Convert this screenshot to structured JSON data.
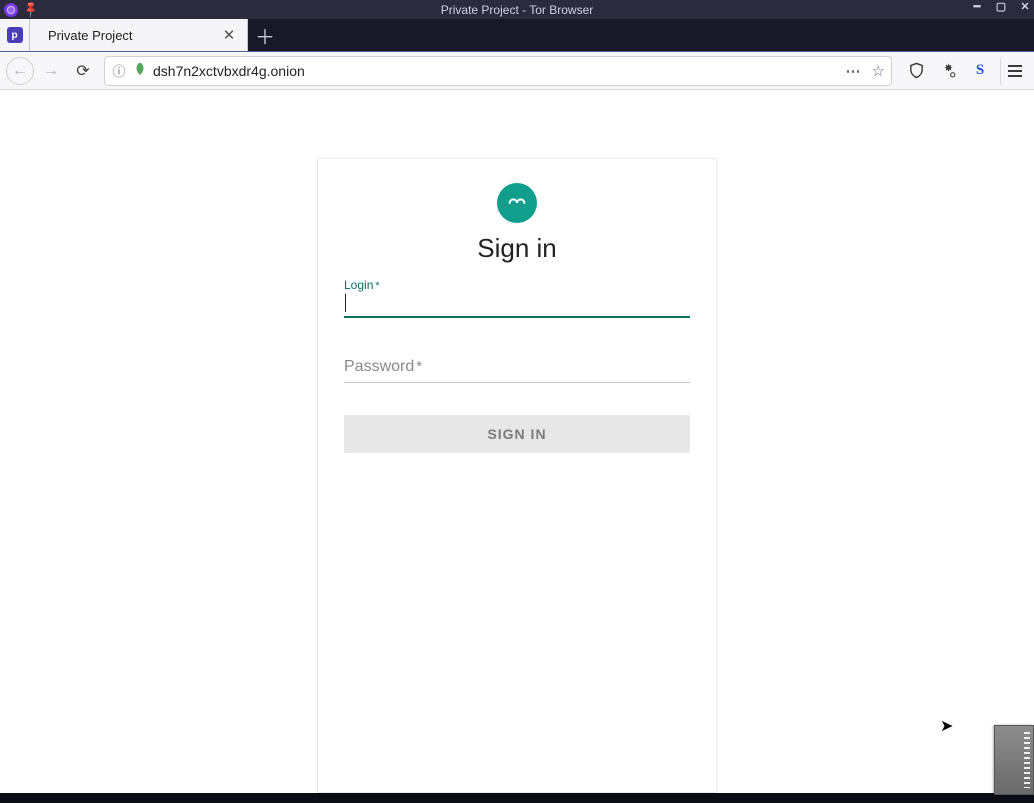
{
  "window": {
    "title": "Private Project - Tor Browser"
  },
  "tabs": {
    "pinned_favicon_letter": "p",
    "active_title": "Private Project"
  },
  "toolbar": {
    "url": "dsh7n2xctvbxdr4g.onion",
    "noscript_letter": "S"
  },
  "page": {
    "heading": "Sign in",
    "login_label": "Login",
    "login_required_mark": "*",
    "login_value": "",
    "password_label": "Password",
    "password_required_mark": "*",
    "password_value": "",
    "submit_label": "SIGN IN"
  },
  "colors": {
    "accent": "#0b6e63",
    "logo_bg": "#119e8c"
  }
}
